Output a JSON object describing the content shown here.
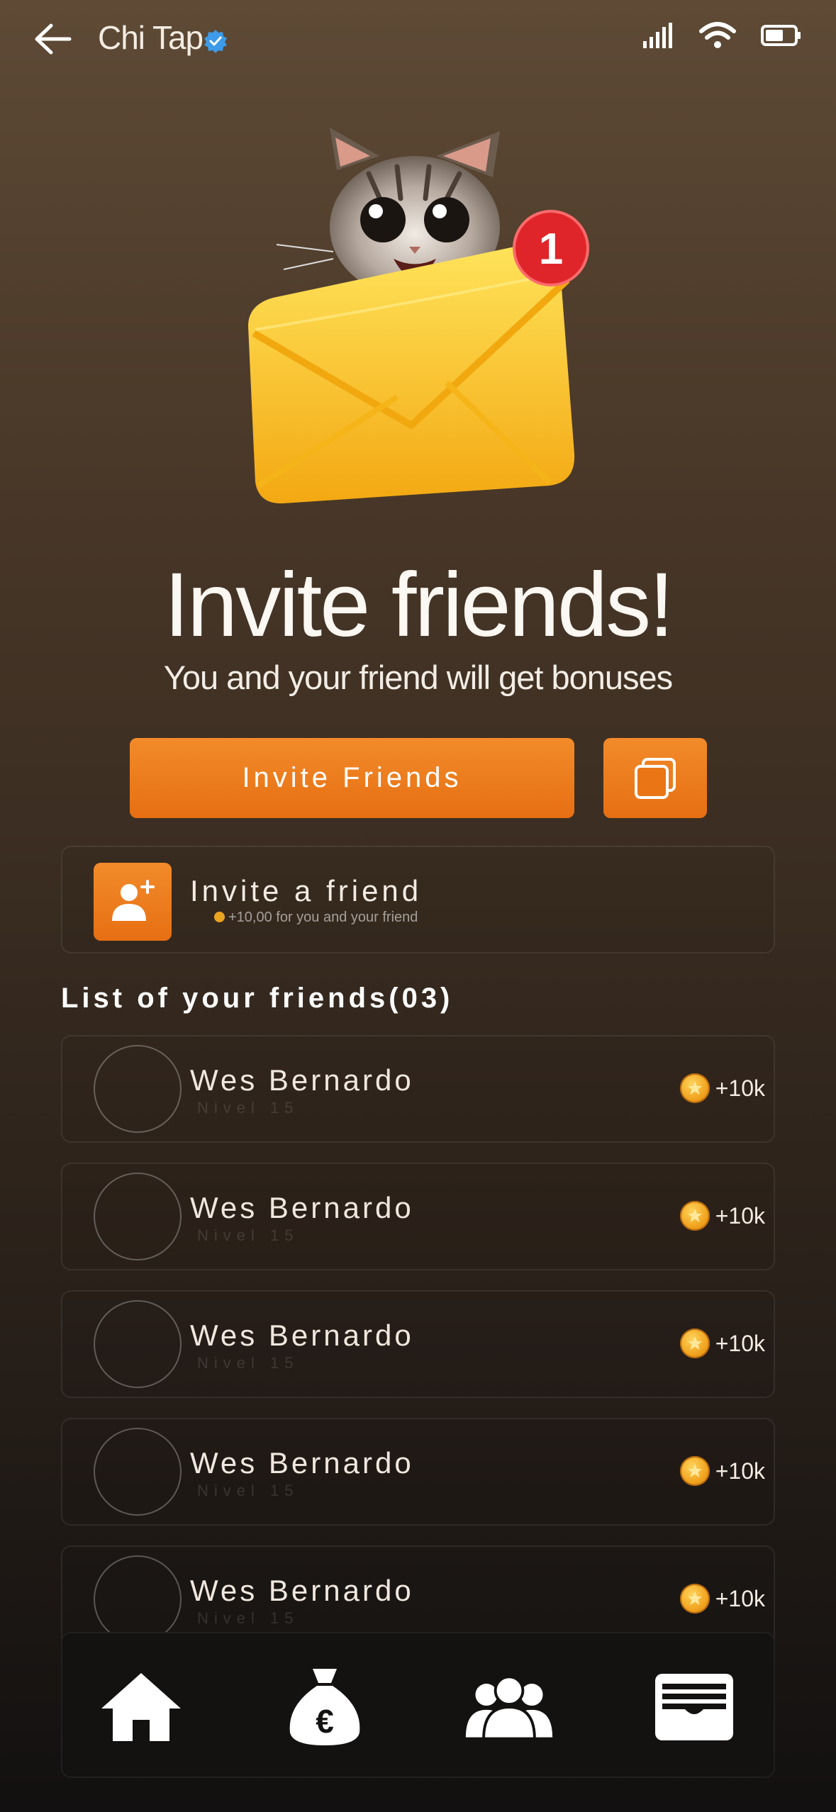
{
  "header": {
    "title": "Chi Tap"
  },
  "hero": {
    "headline": "Invite friends!",
    "subline": "You and your friend will get bonuses",
    "badge_count": "1"
  },
  "actions": {
    "invite_label": "Invite Friends"
  },
  "invite_card": {
    "title": "Invite a friend",
    "subtitle": "+10,00 for you and your friend"
  },
  "friends": {
    "title": "List of your friends(03)",
    "items": [
      {
        "name": "Wes Bernardo",
        "level": "Nivel 15",
        "reward": "+10k"
      },
      {
        "name": "Wes Bernardo",
        "level": "Nivel 15",
        "reward": "+10k"
      },
      {
        "name": "Wes Bernardo",
        "level": "Nivel 15",
        "reward": "+10k"
      },
      {
        "name": "Wes Bernardo",
        "level": "Nivel 15",
        "reward": "+10k"
      },
      {
        "name": "Wes Bernardo",
        "level": "Nivel 15",
        "reward": "+10k"
      }
    ]
  },
  "nav": {
    "items": [
      {
        "icon": "home-icon"
      },
      {
        "icon": "money-bag-icon"
      },
      {
        "icon": "friends-icon"
      },
      {
        "icon": "wallet-icon"
      }
    ]
  },
  "colors": {
    "accent": "#ed7a1c",
    "coin": "#f0a21e",
    "verified": "#3d9be9"
  }
}
